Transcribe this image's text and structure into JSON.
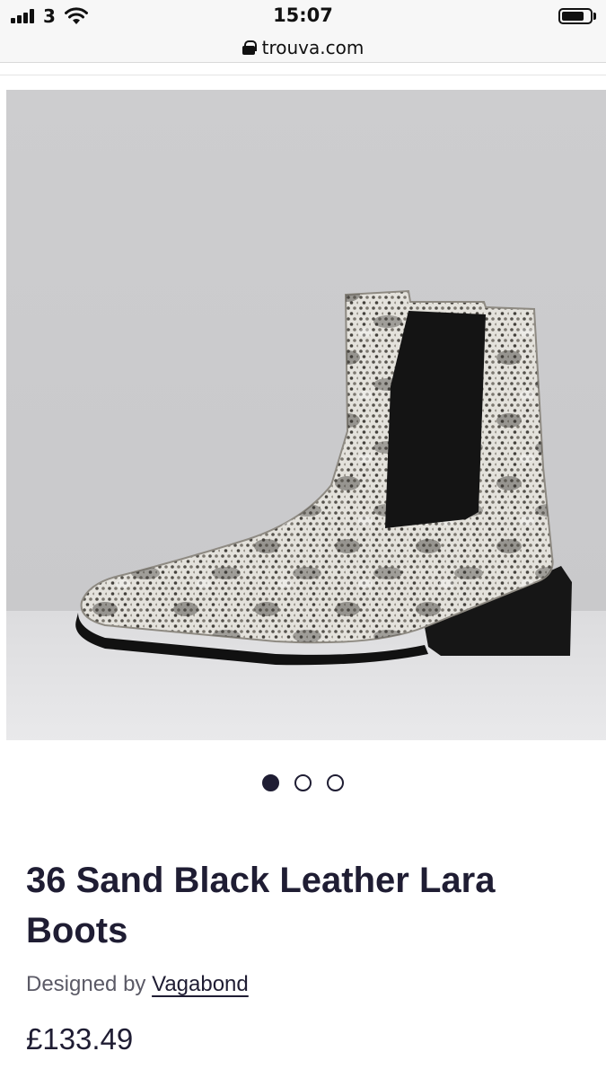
{
  "status_bar": {
    "carrier": "3",
    "time": "15:07",
    "battery_level": 0.8
  },
  "browser": {
    "url": "trouva.com"
  },
  "product": {
    "image_alt": "Snakeskin chelsea boot",
    "carousel": {
      "total": 3,
      "active_index": 0
    },
    "title": "36 Sand Black Leather Lara Boots",
    "designed_by_label": "Designed by",
    "designer": "Vagabond",
    "price": "£133.49"
  },
  "colors": {
    "text_primary": "#1f1d33",
    "text_secondary": "#5b5a66",
    "image_background": "#cbcbcd"
  },
  "icons": {
    "signal": "cellular-signal-icon",
    "wifi": "wifi-icon",
    "battery": "battery-icon",
    "lock": "lock-icon"
  }
}
